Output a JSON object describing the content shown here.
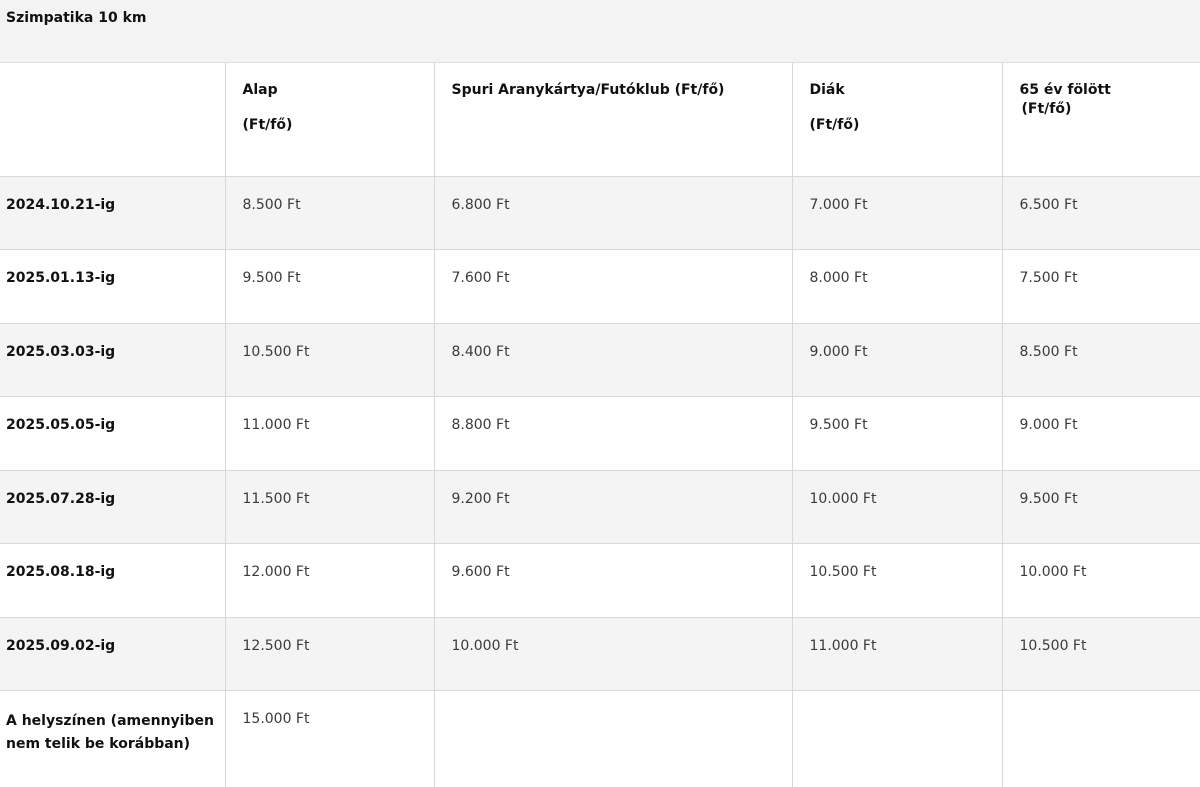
{
  "title": "Szimpatika 10 km",
  "header": {
    "alap_line1": "Alap",
    "alap_line2": "(Ft/fő)",
    "spuri": "Spuri Aranykártya/Futóklub (Ft/fő)",
    "diak_line1": "Diák",
    "diak_line2": "(Ft/fő)",
    "over65_line1": "65 év fölött",
    "over65_line2": "(Ft/fő)"
  },
  "rows": [
    {
      "label": "2024.10.21-ig",
      "alap": "8.500 Ft",
      "spuri": "6.800 Ft",
      "diak": "7.000 Ft",
      "over65": "6.500 Ft"
    },
    {
      "label": "2025.01.13-ig",
      "alap": "9.500 Ft",
      "spuri": "7.600 Ft",
      "diak": "8.000 Ft",
      "over65": "7.500 Ft"
    },
    {
      "label": "2025.03.03-ig",
      "alap": "10.500 Ft",
      "spuri": "8.400 Ft",
      "diak": "9.000 Ft",
      "over65": "8.500 Ft"
    },
    {
      "label": "2025.05.05-ig",
      "alap": "11.000 Ft",
      "spuri": "8.800 Ft",
      "diak": "9.500 Ft",
      "over65": "9.000 Ft"
    },
    {
      "label": "2025.07.28-ig",
      "alap": "11.500 Ft",
      "spuri": "9.200 Ft",
      "diak": "10.000 Ft",
      "over65": "9.500 Ft"
    },
    {
      "label": "2025.08.18-ig",
      "alap": "12.000 Ft",
      "spuri": "9.600 Ft",
      "diak": "10.500 Ft",
      "over65": "10.000 Ft"
    },
    {
      "label": "2025.09.02-ig",
      "alap": "12.500 Ft",
      "spuri": "10.000 Ft",
      "diak": "11.000 Ft",
      "over65": "10.500 Ft"
    }
  ],
  "onsite": {
    "label": "A helyszínen (amennyiben nem telik be korábban)",
    "alap": "15.000 Ft"
  }
}
